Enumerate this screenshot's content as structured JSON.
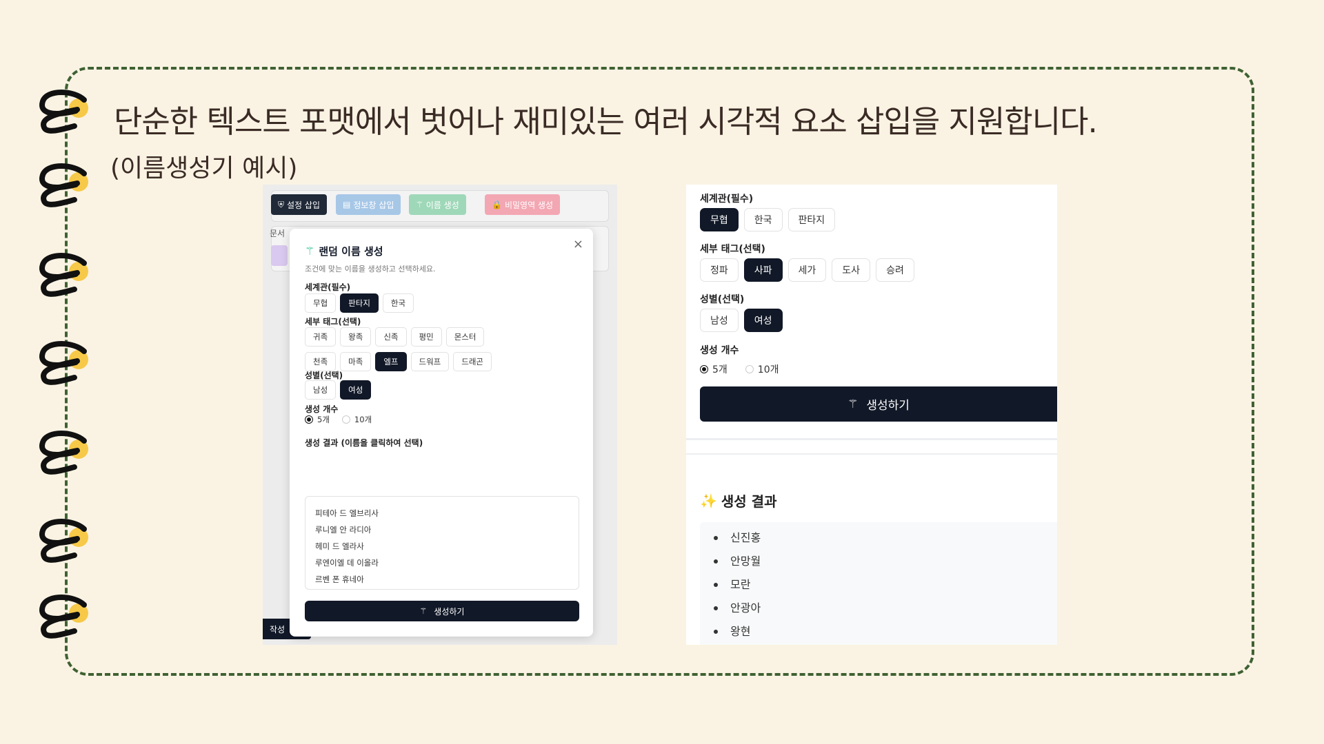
{
  "slide": {
    "headline": "단순한 텍스트 포맷에서 벗어나 재미있는 여러 시각적 요소 삽입을 지원합니다.",
    "subline": "(이름생성기 예시)",
    "colors": {
      "background": "#faf3e3",
      "frame": "#3f6133",
      "ring": "#111111",
      "ring_accent": "#f7c948"
    }
  },
  "left_shot": {
    "toolbar": [
      {
        "label": "설정 삽입",
        "icon": "shield-icon",
        "color": "#1f2937"
      },
      {
        "label": "정보창 삽입",
        "icon": "document-icon",
        "color": "#a7c7e7"
      },
      {
        "label": "이름 생성",
        "icon": "magic-wand-icon",
        "color": "#9fd8b9"
      },
      {
        "label": "비밀영역 생성",
        "icon": "lock-icon",
        "color": "#f3a7b3"
      }
    ],
    "doc_label": "문서",
    "bottom_button": "작성",
    "modal": {
      "title": "랜덤 이름 생성",
      "close": "×",
      "subtitle": "조건에 맞는 이름을 생성하고 선택하세요.",
      "world_label": "세계관(필수)",
      "world_options": [
        {
          "label": "무협",
          "selected": false
        },
        {
          "label": "판타지",
          "selected": true
        },
        {
          "label": "한국",
          "selected": false
        }
      ],
      "tag_label": "세부 태그(선택)",
      "tag_options": [
        {
          "label": "귀족",
          "selected": false
        },
        {
          "label": "왕족",
          "selected": false
        },
        {
          "label": "신족",
          "selected": false
        },
        {
          "label": "평민",
          "selected": false
        },
        {
          "label": "몬스터",
          "selected": false
        },
        {
          "label": "천족",
          "selected": false
        },
        {
          "label": "마족",
          "selected": false
        },
        {
          "label": "엘프",
          "selected": true
        },
        {
          "label": "드워프",
          "selected": false
        },
        {
          "label": "드래곤",
          "selected": false
        }
      ],
      "gender_label": "성별(선택)",
      "gender_options": [
        {
          "label": "남성",
          "selected": false
        },
        {
          "label": "여성",
          "selected": true
        }
      ],
      "count_label": "생성 개수",
      "count_options": [
        {
          "label": "5개",
          "selected": true
        },
        {
          "label": "10개",
          "selected": false
        }
      ],
      "result_label": "생성 결과 (이름을 클릭하여 선택)",
      "results": [
        "피테아 드 엘브리사",
        "루니엘 안 라디아",
        "헤미 드 엘라사",
        "루엔이엘 데 이올라",
        "르벤 폰 휴네아"
      ],
      "generate": "생성하기"
    }
  },
  "right_shot": {
    "world_label": "세계관(필수)",
    "world_options": [
      {
        "label": "무협",
        "selected": true
      },
      {
        "label": "한국",
        "selected": false
      },
      {
        "label": "판타지",
        "selected": false
      }
    ],
    "tag_label": "세부 태그(선택)",
    "tag_options": [
      {
        "label": "정파",
        "selected": false
      },
      {
        "label": "사파",
        "selected": true
      },
      {
        "label": "세가",
        "selected": false
      },
      {
        "label": "도사",
        "selected": false
      },
      {
        "label": "승려",
        "selected": false
      }
    ],
    "gender_label": "성별(선택)",
    "gender_options": [
      {
        "label": "남성",
        "selected": false
      },
      {
        "label": "여성",
        "selected": true
      }
    ],
    "count_label": "생성 개수",
    "count_options": [
      {
        "label": "5개",
        "selected": true
      },
      {
        "label": "10개",
        "selected": false
      }
    ],
    "generate": "생성하기",
    "result_spark": "✨",
    "result_title": "생성 결과",
    "results": [
      "신진홍",
      "안망월",
      "모란",
      "안광아",
      "왕현"
    ]
  }
}
